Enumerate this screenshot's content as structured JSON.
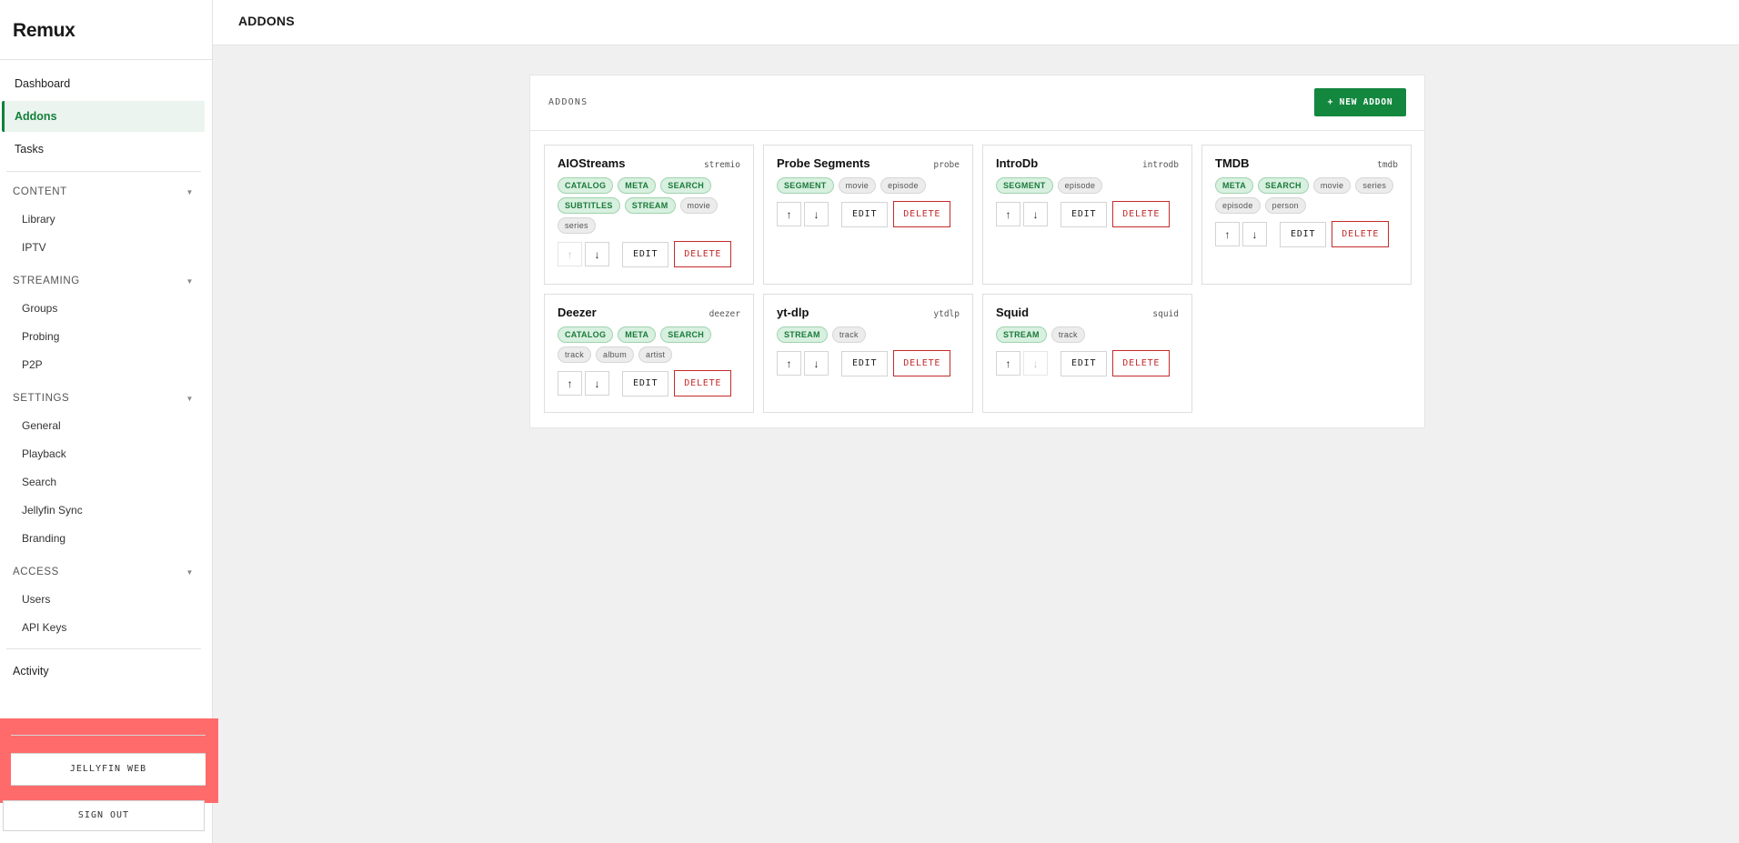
{
  "app": {
    "brand": "Remux"
  },
  "header": {
    "title": "ADDONS"
  },
  "sidebar": {
    "top_items": [
      {
        "label": "Dashboard",
        "active": false
      },
      {
        "label": "Addons",
        "active": true
      },
      {
        "label": "Tasks",
        "active": false
      }
    ],
    "sections": [
      {
        "label": "CONTENT",
        "items": [
          "Library",
          "IPTV"
        ]
      },
      {
        "label": "STREAMING",
        "items": [
          "Groups",
          "Probing",
          "P2P"
        ]
      },
      {
        "label": "SETTINGS",
        "items": [
          "General",
          "Playback",
          "Search",
          "Jellyfin Sync",
          "Branding"
        ]
      },
      {
        "label": "ACCESS",
        "items": [
          "Users",
          "API Keys"
        ]
      }
    ],
    "bottom_item": "Activity",
    "jellyfin_web": "JELLYFIN WEB",
    "sign_out": "SIGN OUT",
    "chevron": "▼"
  },
  "panel": {
    "title": "ADDONS",
    "new_button": "+ NEW ADDON",
    "edit_label": "EDIT",
    "delete_label": "DELETE",
    "addons": [
      {
        "name": "AIOStreams",
        "id": "stremio",
        "capabilities": [
          "CATALOG",
          "META",
          "SEARCH",
          "SUBTITLES",
          "STREAM"
        ],
        "types": [
          "movie",
          "series"
        ],
        "up_disabled": true,
        "down_disabled": false
      },
      {
        "name": "Probe Segments",
        "id": "probe",
        "capabilities": [
          "SEGMENT"
        ],
        "types": [
          "movie",
          "episode"
        ],
        "up_disabled": false,
        "down_disabled": false
      },
      {
        "name": "IntroDb",
        "id": "introdb",
        "capabilities": [
          "SEGMENT"
        ],
        "types": [
          "episode"
        ],
        "up_disabled": false,
        "down_disabled": false
      },
      {
        "name": "TMDB",
        "id": "tmdb",
        "capabilities": [
          "META",
          "SEARCH"
        ],
        "types": [
          "movie",
          "series",
          "episode",
          "person"
        ],
        "up_disabled": false,
        "down_disabled": false
      },
      {
        "name": "Deezer",
        "id": "deezer",
        "capabilities": [
          "CATALOG",
          "META",
          "SEARCH"
        ],
        "types": [
          "track",
          "album",
          "artist"
        ],
        "up_disabled": false,
        "down_disabled": false
      },
      {
        "name": "yt-dlp",
        "id": "ytdlp",
        "capabilities": [
          "STREAM"
        ],
        "types": [
          "track"
        ],
        "up_disabled": false,
        "down_disabled": false
      },
      {
        "name": "Squid",
        "id": "squid",
        "capabilities": [
          "STREAM"
        ],
        "types": [
          "track"
        ],
        "up_disabled": false,
        "down_disabled": true
      }
    ]
  },
  "icons": {
    "up": "↑",
    "down": "↓"
  },
  "colors": {
    "accent": "#14873f",
    "danger": "#c42b2b",
    "highlight": "#ff6b6b"
  }
}
